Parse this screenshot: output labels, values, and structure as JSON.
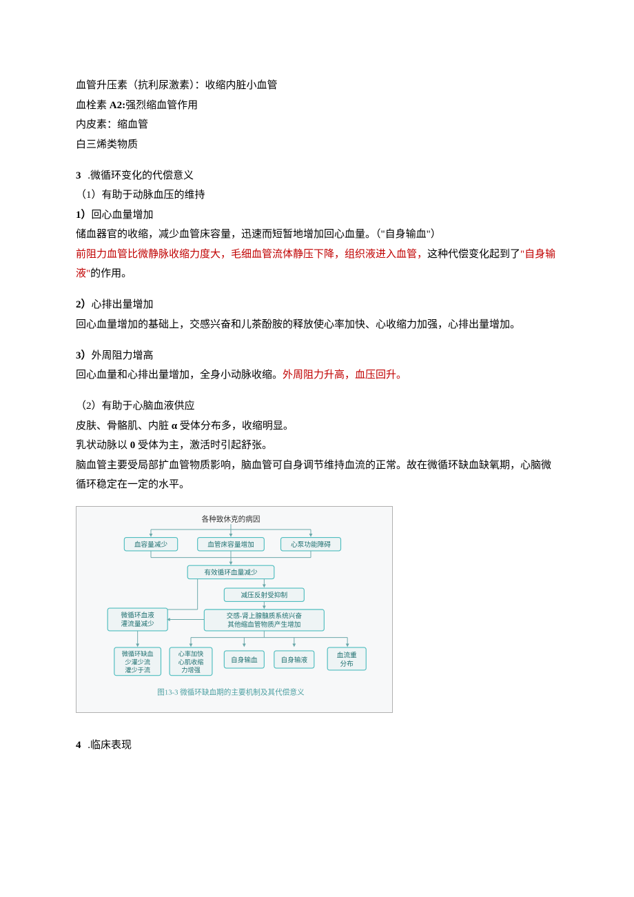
{
  "intro": {
    "l1": "血管升压素（抗利尿激素）：收缩内脏小血管",
    "l2a": "血栓素 ",
    "l2b": "A2:",
    "l2c": "强烈缩血管作用",
    "l3": "内皮素：缩血管",
    "l4": "白三烯类物质"
  },
  "s3": {
    "num": "3",
    "title": " .微循环变化的代偿意义",
    "sub1": "（1）有助于动脉血压的维持",
    "p1_head": "1）",
    "p1_title": "回心血量增加",
    "p1_line1": "储血器官的收缩，减少血管床容量，迅速而短暂地增加回心血量。（\"自身输血\"）",
    "p1_red": "前阻力血管比微静脉收缩力度大，毛细血管流体静压下降，组织液进入血管，",
    "p1_tail": "这种代偿变化起到了",
    "p1_quote": "\"自身输液\"",
    "p1_end": "的作用。",
    "p2_head": "2）",
    "p2_title": "心排出量增加",
    "p2_line": "回心血量增加的基础上，交感兴奋和儿茶酚胺的释放使心率加快、心收缩力加强，心排出量增加。",
    "p3_head": "3）",
    "p3_title": "外周阻力增高",
    "p3_line_a": "回心血量和心排出量增加，全身小动脉收缩。",
    "p3_line_red": "外周阻力升高，血压回升。",
    "sub2": "（2）有助于心脑血液供应",
    "s2_l1a": "皮肤、骨骼肌、内脏 ",
    "s2_l1b": "α",
    "s2_l1c": " 受体分布多，收缩明显。",
    "s2_l2a": "乳状动脉以 ",
    "s2_l2b": "0",
    "s2_l2c": " 受体为主，激活时引起舒张。",
    "s2_l3": "脑血管主要受局部扩血管物质影响，脑血管可自身调节维持血流的正常。故在微循环缺血缺氧期，心脑微循环稳定在一定的水平。"
  },
  "diagram": {
    "top": "各种致休克的病因",
    "n1": "血容量减少",
    "n2": "血管床容量增加",
    "n3": "心泵功能障碍",
    "n4": "有效循环血量减少",
    "n5": "减压反射受抑制",
    "n6a": "微循环血液",
    "n6b": "灌流量减少",
    "n7a": "交感-肾上腺髓质系统兴奋",
    "n7b": "其他缩血管物质产生增加",
    "b1a": "微循环缺血",
    "b1b": "少灌少流",
    "b1c": "灌少于流",
    "b2a": "心率加快",
    "b2b": "心肌收缩",
    "b2c": "力增强",
    "b3": "自身输血",
    "b4": "自身输液",
    "b5a": "血流重",
    "b5b": "分布",
    "caption_a": "图13-3",
    "caption_b": " 微循环缺血期的主要机制及其代偿意义"
  },
  "s4": {
    "num": "4",
    "title": " .临床表现"
  },
  "colors": {
    "red": "#c00000",
    "teal_a": "#2f9e9e",
    "teal_b": "#4fbdbf",
    "teal_dk": "#1f7070",
    "box_fill": "#eef4f5",
    "arrow": "#6aa7a9",
    "caption": "#4da0a2"
  }
}
